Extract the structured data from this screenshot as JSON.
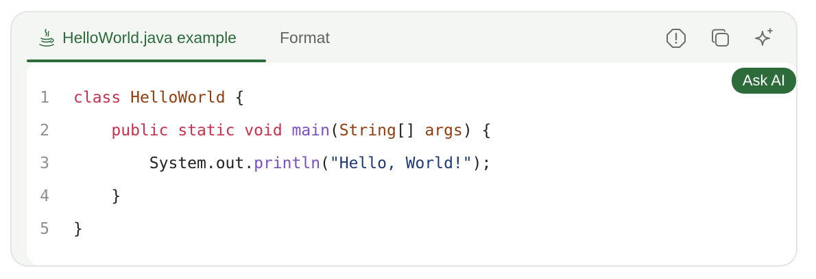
{
  "tabs": [
    {
      "label": "HelloWorld.java example",
      "icon": "java-icon",
      "active": true
    },
    {
      "label": "Format",
      "active": false
    }
  ],
  "toolbar": {
    "report_icon": "alert-octagon-icon",
    "copy_icon": "copy-icon",
    "ai_icon": "sparkle-icon"
  },
  "ask_ai": {
    "label": "Ask AI"
  },
  "code": {
    "language": "java",
    "lines": [
      {
        "number": "1",
        "text": "class HelloWorld {"
      },
      {
        "number": "2",
        "text": "    public static void main(String[] args) {"
      },
      {
        "number": "3",
        "text": "        System.out.println(\"Hello, World!\");"
      },
      {
        "number": "4",
        "text": "    }"
      },
      {
        "number": "5",
        "text": "}"
      }
    ],
    "tokens": [
      {
        "line": 1,
        "parts": [
          {
            "t": "class",
            "c": "kw"
          },
          {
            "t": " ",
            "c": "pl"
          },
          {
            "t": "HelloWorld",
            "c": "cls"
          },
          {
            "t": " {",
            "c": "pl"
          }
        ]
      },
      {
        "line": 2,
        "parts": [
          {
            "t": "    ",
            "c": "pl"
          },
          {
            "t": "public",
            "c": "kw"
          },
          {
            "t": " ",
            "c": "pl"
          },
          {
            "t": "static",
            "c": "kw"
          },
          {
            "t": " ",
            "c": "pl"
          },
          {
            "t": "void",
            "c": "kw"
          },
          {
            "t": " ",
            "c": "pl"
          },
          {
            "t": "main",
            "c": "fn"
          },
          {
            "t": "(",
            "c": "pl"
          },
          {
            "t": "String",
            "c": "cls"
          },
          {
            "t": "[] ",
            "c": "pl"
          },
          {
            "t": "args",
            "c": "cls"
          },
          {
            "t": ") {",
            "c": "pl"
          }
        ]
      },
      {
        "line": 3,
        "parts": [
          {
            "t": "        System.out.",
            "c": "pl"
          },
          {
            "t": "println",
            "c": "fn"
          },
          {
            "t": "(",
            "c": "pl"
          },
          {
            "t": "\"Hello, World!\"",
            "c": "str"
          },
          {
            "t": ");",
            "c": "pl"
          }
        ]
      },
      {
        "line": 4,
        "parts": [
          {
            "t": "    }",
            "c": "pl"
          }
        ]
      },
      {
        "line": 5,
        "parts": [
          {
            "t": "}",
            "c": "pl"
          }
        ]
      }
    ]
  },
  "colors": {
    "accent": "#2e6b3a",
    "keyword": "#c4334d",
    "type": "#8f3e12",
    "function": "#7a4fc4",
    "string": "#1e3a73",
    "line_number": "#8c8f8d"
  }
}
